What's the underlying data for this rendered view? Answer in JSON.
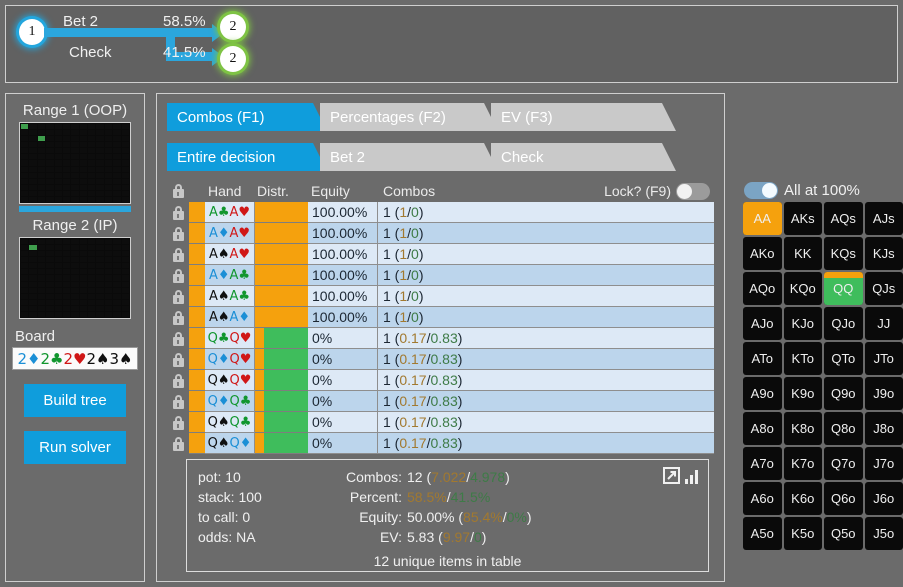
{
  "tree": {
    "root_node": "1",
    "branches": [
      {
        "label": "Bet 2",
        "percent": "58.5%",
        "target_node": "2"
      },
      {
        "label": "Check",
        "percent": "41.5%",
        "target_node": "2"
      }
    ]
  },
  "sidebar": {
    "range1_title": "Range 1 (OOP)",
    "range2_title": "Range 2 (IP)",
    "range1_selected": [
      0,
      28
    ],
    "range2_selected": [
      14
    ],
    "board_label": "Board",
    "board_cards": [
      {
        "rank": "2",
        "suit": "♦",
        "color": "d"
      },
      {
        "rank": "2",
        "suit": "♣",
        "color": "g"
      },
      {
        "rank": "2",
        "suit": "♥",
        "color": "r"
      },
      {
        "rank": "2",
        "suit": "♠",
        "color": "b"
      },
      {
        "rank": "3",
        "suit": "♠",
        "color": "b"
      }
    ],
    "build_tree_label": "Build tree",
    "run_solver_label": "Run solver"
  },
  "tabs_primary": [
    {
      "label": "Combos (F1)",
      "active": true
    },
    {
      "label": "Percentages (F2)",
      "active": false
    },
    {
      "label": "EV (F3)",
      "active": false
    }
  ],
  "tabs_secondary": [
    {
      "label": "Entire decision",
      "active": true
    },
    {
      "label": "Bet 2",
      "active": false
    },
    {
      "label": "Check",
      "active": false
    }
  ],
  "table": {
    "headers": {
      "lock": "",
      "hand": "Hand",
      "distr": "Distr.",
      "equity": "Equity",
      "combos": "Combos",
      "lock_question": "Lock? (F9)"
    },
    "lock_toggle_on": false,
    "rows": [
      {
        "hand": [
          {
            "r": "A",
            "s": "♣",
            "c": "g"
          },
          {
            "r": "A",
            "s": "♥",
            "c": "r"
          }
        ],
        "distr": [
          {
            "color": "#f5a10d",
            "pct": 100
          }
        ],
        "equity": "100.00%",
        "combos_main": "1",
        "combos_a": "1",
        "combos_b": "0"
      },
      {
        "hand": [
          {
            "r": "A",
            "s": "♦",
            "c": "d"
          },
          {
            "r": "A",
            "s": "♥",
            "c": "r"
          }
        ],
        "distr": [
          {
            "color": "#f5a10d",
            "pct": 100
          }
        ],
        "equity": "100.00%",
        "combos_main": "1",
        "combos_a": "1",
        "combos_b": "0"
      },
      {
        "hand": [
          {
            "r": "A",
            "s": "♠",
            "c": "b"
          },
          {
            "r": "A",
            "s": "♥",
            "c": "r"
          }
        ],
        "distr": [
          {
            "color": "#f5a10d",
            "pct": 100
          }
        ],
        "equity": "100.00%",
        "combos_main": "1",
        "combos_a": "1",
        "combos_b": "0"
      },
      {
        "hand": [
          {
            "r": "A",
            "s": "♦",
            "c": "d"
          },
          {
            "r": "A",
            "s": "♣",
            "c": "g"
          }
        ],
        "distr": [
          {
            "color": "#f5a10d",
            "pct": 100
          }
        ],
        "equity": "100.00%",
        "combos_main": "1",
        "combos_a": "1",
        "combos_b": "0"
      },
      {
        "hand": [
          {
            "r": "A",
            "s": "♠",
            "c": "b"
          },
          {
            "r": "A",
            "s": "♣",
            "c": "g"
          }
        ],
        "distr": [
          {
            "color": "#f5a10d",
            "pct": 100
          }
        ],
        "equity": "100.00%",
        "combos_main": "1",
        "combos_a": "1",
        "combos_b": "0"
      },
      {
        "hand": [
          {
            "r": "A",
            "s": "♠",
            "c": "b"
          },
          {
            "r": "A",
            "s": "♦",
            "c": "d"
          }
        ],
        "distr": [
          {
            "color": "#f5a10d",
            "pct": 100
          }
        ],
        "equity": "100.00%",
        "combos_main": "1",
        "combos_a": "1",
        "combos_b": "0"
      },
      {
        "hand": [
          {
            "r": "Q",
            "s": "♣",
            "c": "g"
          },
          {
            "r": "Q",
            "s": "♥",
            "c": "r"
          }
        ],
        "distr": [
          {
            "color": "#f5a10d",
            "pct": 17
          },
          {
            "color": "#3fbd5c",
            "pct": 83
          }
        ],
        "equity": "0%",
        "combos_main": "1",
        "combos_a": "0.17",
        "combos_b": "0.83"
      },
      {
        "hand": [
          {
            "r": "Q",
            "s": "♦",
            "c": "d"
          },
          {
            "r": "Q",
            "s": "♥",
            "c": "r"
          }
        ],
        "distr": [
          {
            "color": "#f5a10d",
            "pct": 17
          },
          {
            "color": "#3fbd5c",
            "pct": 83
          }
        ],
        "equity": "0%",
        "combos_main": "1",
        "combos_a": "0.17",
        "combos_b": "0.83"
      },
      {
        "hand": [
          {
            "r": "Q",
            "s": "♠",
            "c": "b"
          },
          {
            "r": "Q",
            "s": "♥",
            "c": "r"
          }
        ],
        "distr": [
          {
            "color": "#f5a10d",
            "pct": 17
          },
          {
            "color": "#3fbd5c",
            "pct": 83
          }
        ],
        "equity": "0%",
        "combos_main": "1",
        "combos_a": "0.17",
        "combos_b": "0.83"
      },
      {
        "hand": [
          {
            "r": "Q",
            "s": "♦",
            "c": "d"
          },
          {
            "r": "Q",
            "s": "♣",
            "c": "g"
          }
        ],
        "distr": [
          {
            "color": "#f5a10d",
            "pct": 17
          },
          {
            "color": "#3fbd5c",
            "pct": 83
          }
        ],
        "equity": "0%",
        "combos_main": "1",
        "combos_a": "0.17",
        "combos_b": "0.83"
      },
      {
        "hand": [
          {
            "r": "Q",
            "s": "♠",
            "c": "b"
          },
          {
            "r": "Q",
            "s": "♣",
            "c": "g"
          }
        ],
        "distr": [
          {
            "color": "#f5a10d",
            "pct": 17
          },
          {
            "color": "#3fbd5c",
            "pct": 83
          }
        ],
        "equity": "0%",
        "combos_main": "1",
        "combos_a": "0.17",
        "combos_b": "0.83"
      },
      {
        "hand": [
          {
            "r": "Q",
            "s": "♠",
            "c": "b"
          },
          {
            "r": "Q",
            "s": "♦",
            "c": "d"
          }
        ],
        "distr": [
          {
            "color": "#f5a10d",
            "pct": 17
          },
          {
            "color": "#3fbd5c",
            "pct": 83
          }
        ],
        "equity": "0%",
        "combos_main": "1",
        "combos_a": "0.17",
        "combos_b": "0.83"
      }
    ]
  },
  "stats": {
    "pot": "pot: 10",
    "stack": "stack: 100",
    "to_call": "to call: 0",
    "odds": "odds: NA",
    "combos_label": "Combos:",
    "combos_value": "12",
    "combos_a": "7.022",
    "combos_b": "4.978",
    "percent_label": "Percent:",
    "percent_a": "58.5%",
    "percent_b": "41.5%",
    "equity_label": "Equity:",
    "equity_value": "50.00%",
    "equity_a": "85.4%",
    "equity_b": "0%",
    "ev_label": "EV:",
    "ev_value": "5.83",
    "ev_a": "9.97",
    "ev_b": "0",
    "footer": "12 unique items in table"
  },
  "matrix": {
    "all_at_label": "All at 100%",
    "all_at_on": true,
    "cells": [
      {
        "label": "AA",
        "fill": "full",
        "top": "#f5a10d"
      },
      {
        "label": "AKs",
        "fill": "none"
      },
      {
        "label": "AQs",
        "fill": "none"
      },
      {
        "label": "AJs",
        "fill": "none"
      },
      {
        "label": "AKo",
        "fill": "none"
      },
      {
        "label": "KK",
        "fill": "none"
      },
      {
        "label": "KQs",
        "fill": "none"
      },
      {
        "label": "KJs",
        "fill": "none"
      },
      {
        "label": "AQo",
        "fill": "none"
      },
      {
        "label": "KQo",
        "fill": "none"
      },
      {
        "label": "QQ",
        "fill": "split",
        "top": "#f5a10d",
        "bottom": "#3fbd5c"
      },
      {
        "label": "QJs",
        "fill": "none"
      },
      {
        "label": "AJo",
        "fill": "none"
      },
      {
        "label": "KJo",
        "fill": "none"
      },
      {
        "label": "QJo",
        "fill": "none"
      },
      {
        "label": "JJ",
        "fill": "none"
      },
      {
        "label": "ATo",
        "fill": "none"
      },
      {
        "label": "KTo",
        "fill": "none"
      },
      {
        "label": "QTo",
        "fill": "none"
      },
      {
        "label": "JTo",
        "fill": "none"
      },
      {
        "label": "A9o",
        "fill": "none"
      },
      {
        "label": "K9o",
        "fill": "none"
      },
      {
        "label": "Q9o",
        "fill": "none"
      },
      {
        "label": "J9o",
        "fill": "none"
      },
      {
        "label": "A8o",
        "fill": "none"
      },
      {
        "label": "K8o",
        "fill": "none"
      },
      {
        "label": "Q8o",
        "fill": "none"
      },
      {
        "label": "J8o",
        "fill": "none"
      },
      {
        "label": "A7o",
        "fill": "none"
      },
      {
        "label": "K7o",
        "fill": "none"
      },
      {
        "label": "Q7o",
        "fill": "none"
      },
      {
        "label": "J7o",
        "fill": "none"
      },
      {
        "label": "A6o",
        "fill": "none"
      },
      {
        "label": "K6o",
        "fill": "none"
      },
      {
        "label": "Q6o",
        "fill": "none"
      },
      {
        "label": "J6o",
        "fill": "none"
      },
      {
        "label": "A5o",
        "fill": "none"
      },
      {
        "label": "K5o",
        "fill": "none"
      },
      {
        "label": "Q5o",
        "fill": "none"
      },
      {
        "label": "J5o",
        "fill": "none"
      }
    ]
  },
  "colors": {
    "accent_blue": "#0f9ddc",
    "orange": "#f5a10d",
    "green": "#3fbd5c",
    "background": "#6b6b6b"
  }
}
